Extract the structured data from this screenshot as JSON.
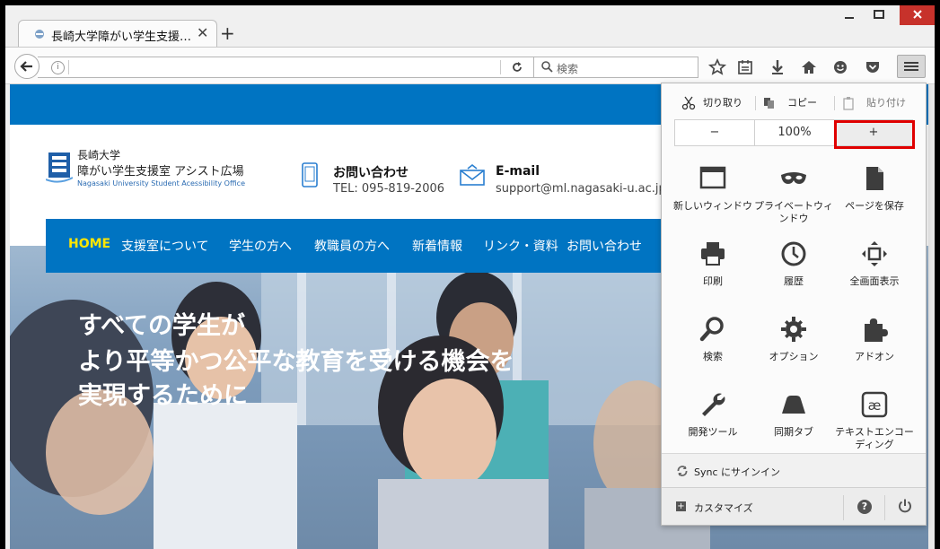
{
  "browser": {
    "tab_title": "長崎大学障がい学生支援…",
    "tab_close": "✕",
    "new_tab": "+",
    "search_placeholder": "検索"
  },
  "site": {
    "logo_line1": "長崎大学",
    "logo_line2": "障がい学生支援室 アシスト広場",
    "logo_line3": "Nagasaki University Student Acessibility Office",
    "contact1_title": "お問い合わせ",
    "contact1_value": "TEL: 095-819-2006",
    "contact2_title": "E-mail",
    "contact2_value": "support@ml.nagasaki-u.ac.jp",
    "nav": [
      "HOME",
      "支援室について",
      "学生の方へ",
      "教職員の方へ",
      "新着情報",
      "リンク・資料",
      "お問い合わせ"
    ],
    "hero_lines": [
      "すべての学生が",
      "より平等かつ公平な教育を受ける機会を",
      "実現するために"
    ]
  },
  "menu": {
    "cut": "切り取り",
    "copy": "コピー",
    "paste": "貼り付け",
    "zoom_out": "−",
    "zoom_level": "100%",
    "zoom_in": "+",
    "items": [
      {
        "label": "新しいウィンドウ"
      },
      {
        "label": "プライベートウィンドウ"
      },
      {
        "label": "ページを保存"
      },
      {
        "label": "印刷"
      },
      {
        "label": "履歴"
      },
      {
        "label": "全画面表示"
      },
      {
        "label": "検索"
      },
      {
        "label": "オプション"
      },
      {
        "label": "アドオン"
      },
      {
        "label": "開発ツール"
      },
      {
        "label": "同期タブ"
      },
      {
        "label": "テキストエンコーディング"
      }
    ],
    "sync": "Sync にサインイン",
    "customize": "カスタマイズ",
    "help": "?"
  },
  "colors": {
    "site_blue": "#0074c2",
    "nav_active": "#ffe600",
    "highlight": "#e00000"
  }
}
